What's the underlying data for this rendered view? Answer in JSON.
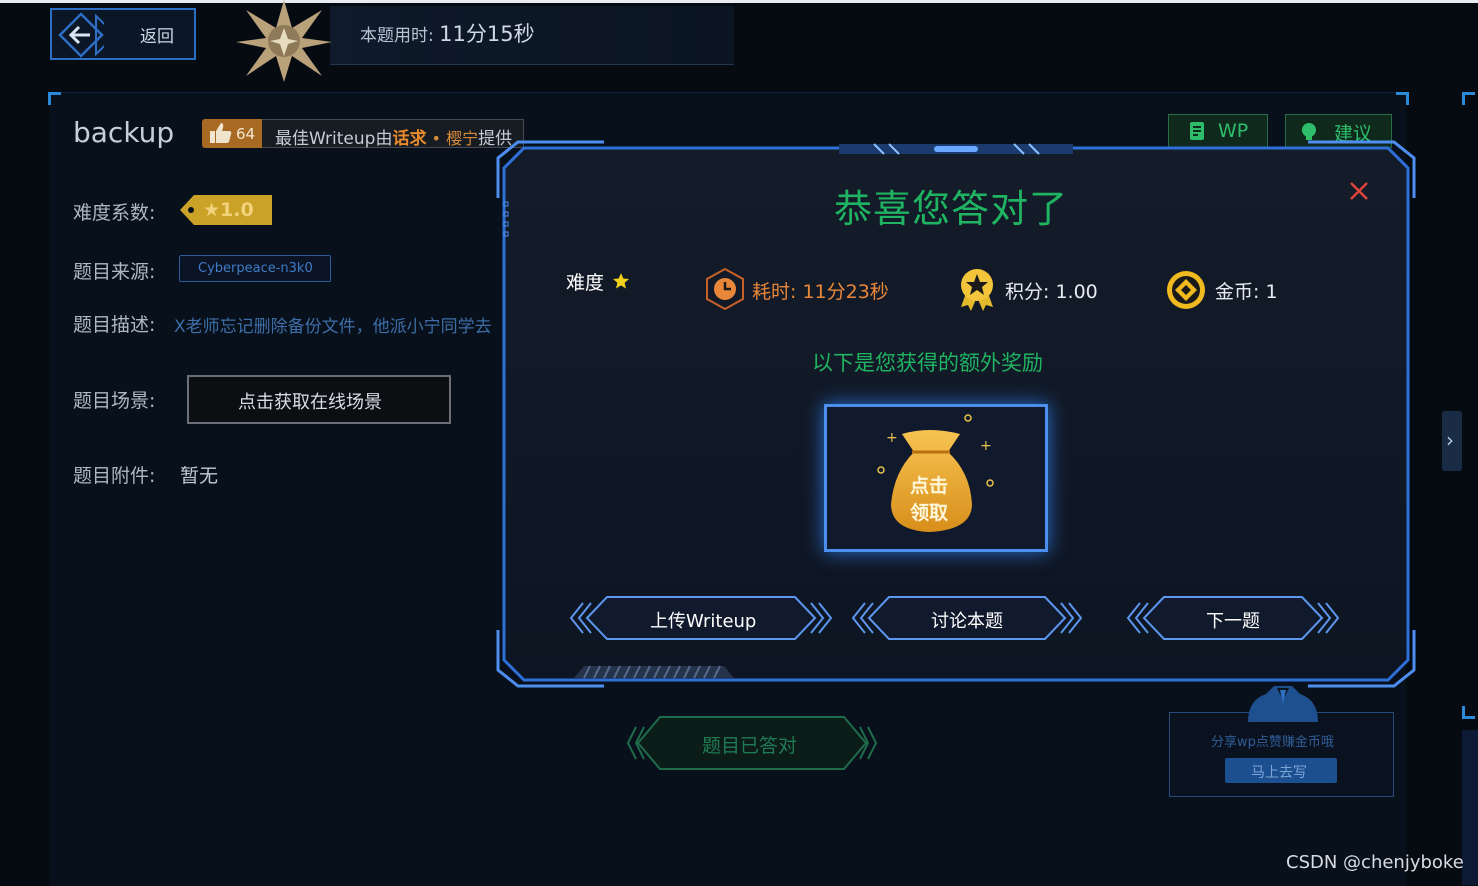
{
  "header": {
    "back_label": "返回",
    "timer_label": "本题用时: ",
    "timer_value": "11分15秒"
  },
  "problem": {
    "title": "backup",
    "likes": "64",
    "writeup_prefix": "最佳Writeup由",
    "writeup_team": "话求",
    "writeup_sep": " • ",
    "writeup_user": "樱宁",
    "writeup_suffix": "提供",
    "difficulty_label": "难度系数:",
    "difficulty_value": "★1.0",
    "source_label": "题目来源:",
    "source_value": "Cyberpeace-n3k0",
    "desc_label": "题目描述:",
    "desc_value": "X老师忘记删除备份文件，他派小宁同学去",
    "scene_label": "题目场景:",
    "scene_button": "点击获取在线场景",
    "attach_label": "题目附件:",
    "attach_value": "暂无",
    "answered_button": "题目已答对"
  },
  "actions": {
    "wp_label": "WP",
    "suggest_label": "建议"
  },
  "share": {
    "text": "分享wp点赞赚金币哦",
    "button": "马上去写"
  },
  "watermark": "CSDN @chenjyboke",
  "modal": {
    "title": "恭喜您答对了",
    "difficulty_label": "难度",
    "time_label": "耗时: 11分23秒",
    "score_label": "积分: 1.00",
    "coin_label": "金币: 1",
    "extra_title": "以下是您获得的额外奖励",
    "bag_text_1": "点击",
    "bag_text_2": "领取",
    "upload_button": "上传Writeup",
    "discuss_button": "讨论本题",
    "next_button": "下一题"
  },
  "colors": {
    "accent_green": "#1fb362",
    "accent_blue": "#4d8ff0",
    "accent_orange": "#e8873a",
    "close_red": "#e0443a"
  }
}
